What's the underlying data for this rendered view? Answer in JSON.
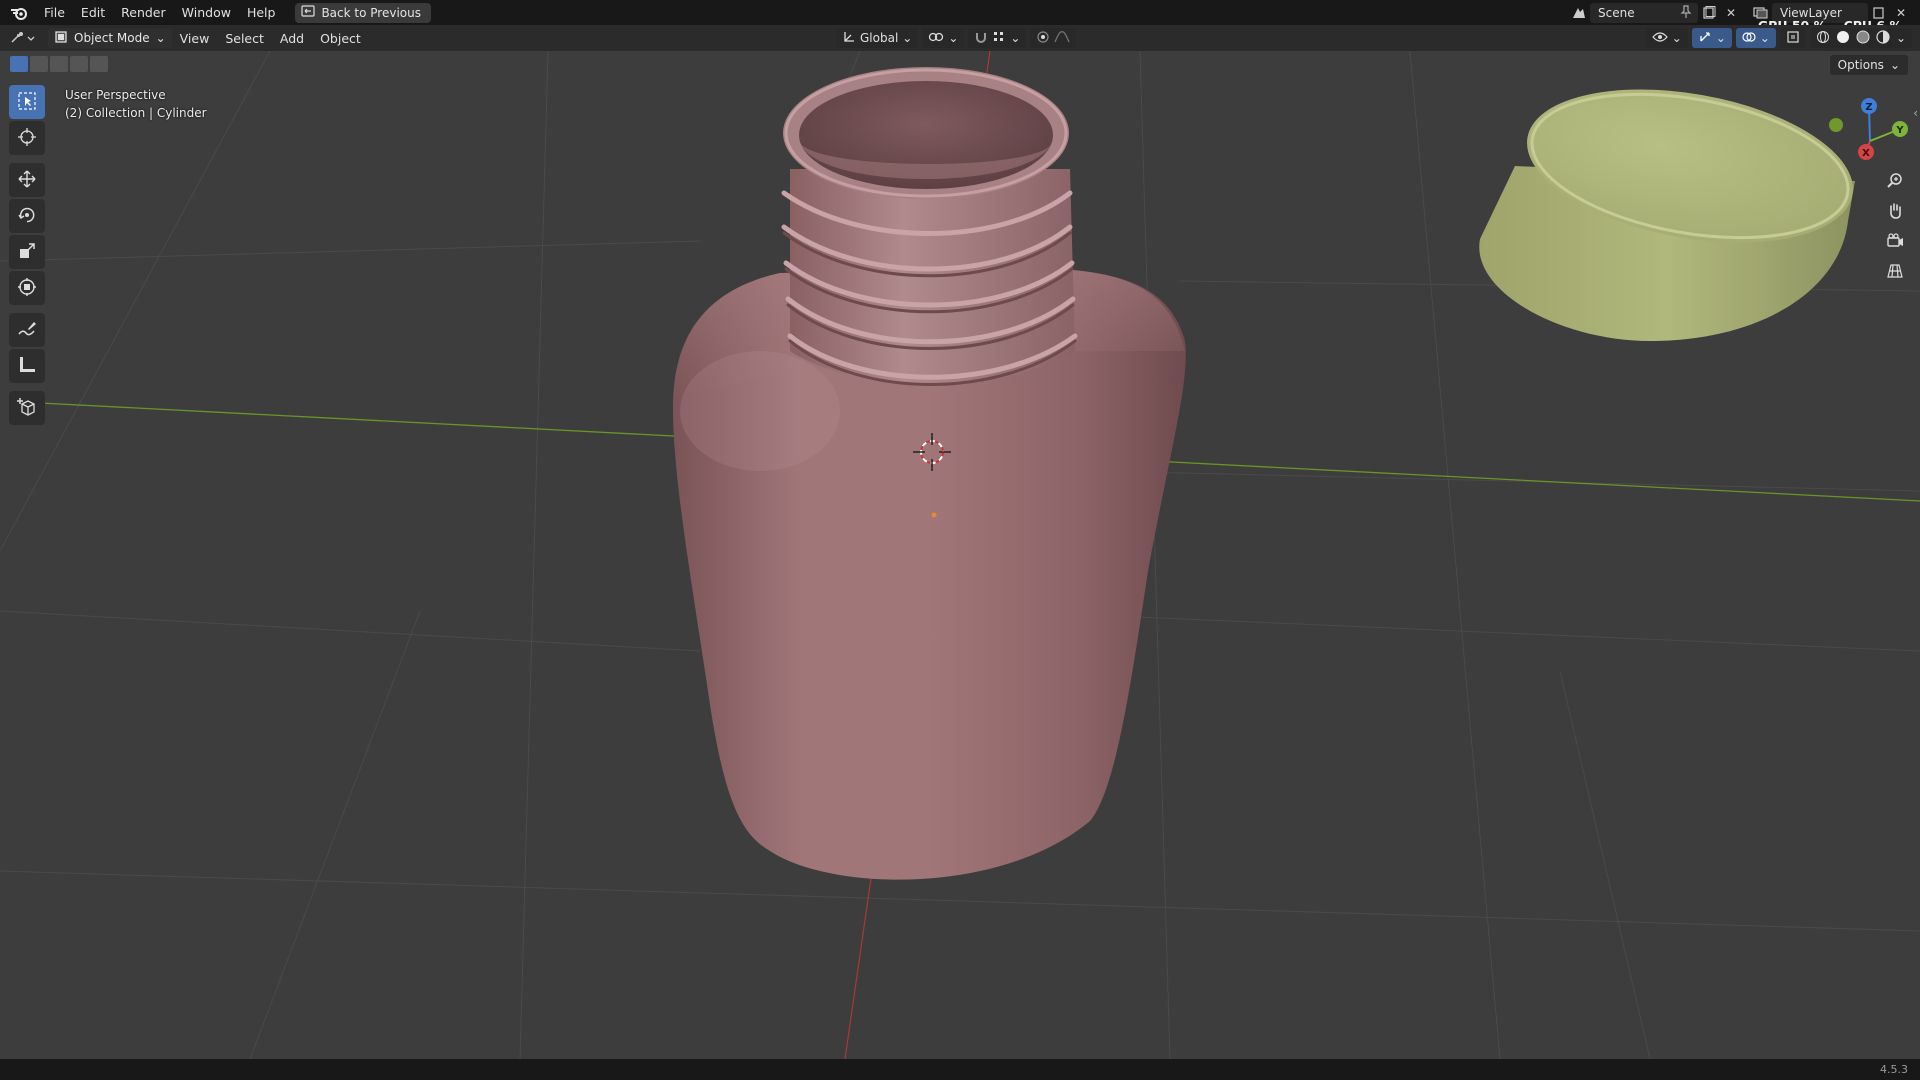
{
  "menu": {
    "items": [
      "File",
      "Edit",
      "Render",
      "Window",
      "Help"
    ],
    "back_button": "Back to Previous"
  },
  "top_right": {
    "scene": "Scene",
    "view_layer": "ViewLayer",
    "gpu_label": "GPU",
    "gpu_value": "50 %",
    "cpu_label": "CPU",
    "cpu_value": "6 %"
  },
  "header": {
    "mode": "Object Mode",
    "menus": [
      "View",
      "Select",
      "Add",
      "Object"
    ],
    "transform_orientation": "Global"
  },
  "viewport": {
    "perspective": "User Perspective",
    "collection_info": "(2) Collection | Cylinder",
    "options_label": "Options"
  },
  "toolbar": {
    "tools": [
      "select-box",
      "cursor",
      "move",
      "rotate",
      "scale",
      "transform",
      "annotate",
      "measure",
      "add-cube"
    ],
    "active": "select-box"
  },
  "gizmo": {
    "z": "Z",
    "y": "Y",
    "x": "X"
  },
  "status": {
    "version": "4.5.3"
  },
  "colors": {
    "bottle": "#9d7276",
    "cap": "#b1bb7e",
    "axis_x": "#b03a3a",
    "axis_y": "#6f9a2a",
    "accent": "#4772b3"
  }
}
